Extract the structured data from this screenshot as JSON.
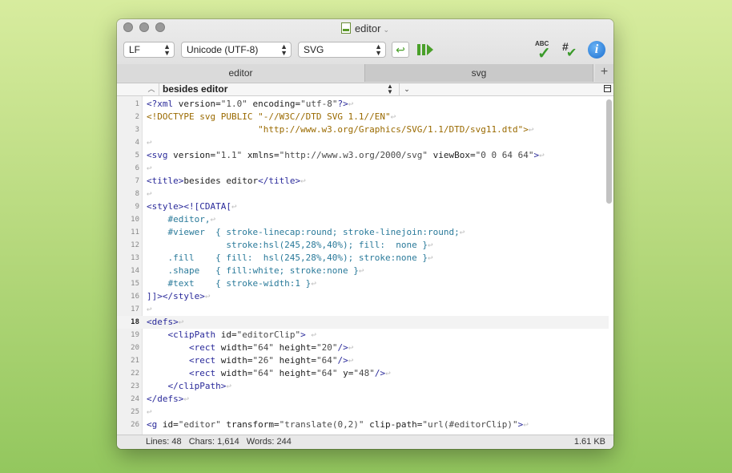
{
  "window": {
    "title": "editor",
    "line_ending": "LF",
    "encoding": "Unicode (UTF-8)",
    "syntax": "SVG"
  },
  "tabs": [
    {
      "label": "editor"
    },
    {
      "label": "svg"
    }
  ],
  "tab_add": "+",
  "navigation": {
    "crumb": "besides editor"
  },
  "status": {
    "lines": "Lines: 48",
    "chars": "Chars: 1,614",
    "words": "Words: 244",
    "size": "1.61 KB"
  },
  "icons": {
    "abc": "ABC",
    "info": "i"
  },
  "colors": {
    "accent_green": "#4aa02a",
    "info_blue": "#1c6fcf",
    "tag_blue": "#2a2a9a",
    "attr_gold": "#8a7a00"
  },
  "code_lines": [
    {
      "num": "1",
      "text": "<?xml version=\"1.0\" encoding=\"utf-8\"?>"
    },
    {
      "num": "2",
      "text": "<!DOCTYPE svg PUBLIC \"-//W3C//DTD SVG 1.1//EN\""
    },
    {
      "num": "3",
      "text": "                     \"http://www.w3.org/Graphics/SVG/1.1/DTD/svg11.dtd\">"
    },
    {
      "num": "4",
      "text": ""
    },
    {
      "num": "5",
      "text": "<svg version=\"1.1\" xmlns=\"http://www.w3.org/2000/svg\" viewBox=\"0 0 64 64\">"
    },
    {
      "num": "6",
      "text": ""
    },
    {
      "num": "7",
      "text": "<title>besides editor</title>"
    },
    {
      "num": "8",
      "text": ""
    },
    {
      "num": "9",
      "text": "<style><![CDATA["
    },
    {
      "num": "10",
      "text": "    #editor,"
    },
    {
      "num": "11",
      "text": "    #viewer  { stroke-linecap:round; stroke-linejoin:round;"
    },
    {
      "num": "12",
      "text": "               stroke:hsl(245,28%,40%); fill:  none }"
    },
    {
      "num": "13",
      "text": "    .fill    { fill:  hsl(245,28%,40%); stroke:none }"
    },
    {
      "num": "14",
      "text": "    .shape   { fill:white; stroke:none }"
    },
    {
      "num": "15",
      "text": "    #text    { stroke-width:1 }"
    },
    {
      "num": "16",
      "text": "]]></style>"
    },
    {
      "num": "17",
      "text": ""
    },
    {
      "num": "18",
      "text": "<defs>"
    },
    {
      "num": "19",
      "text": "    <clipPath id=\"editorClip\"> "
    },
    {
      "num": "20",
      "text": "        <rect width=\"64\" height=\"20\"/>"
    },
    {
      "num": "21",
      "text": "        <rect width=\"26\" height=\"64\"/>"
    },
    {
      "num": "22",
      "text": "        <rect width=\"64\" height=\"64\" y=\"48\"/>"
    },
    {
      "num": "23",
      "text": "    </clipPath>"
    },
    {
      "num": "24",
      "text": "</defs>"
    },
    {
      "num": "25",
      "text": ""
    },
    {
      "num": "26",
      "text": "<g id=\"editor\" transform=\"translate(0,2)\" clip-path=\"url(#editorClip)\">"
    }
  ]
}
